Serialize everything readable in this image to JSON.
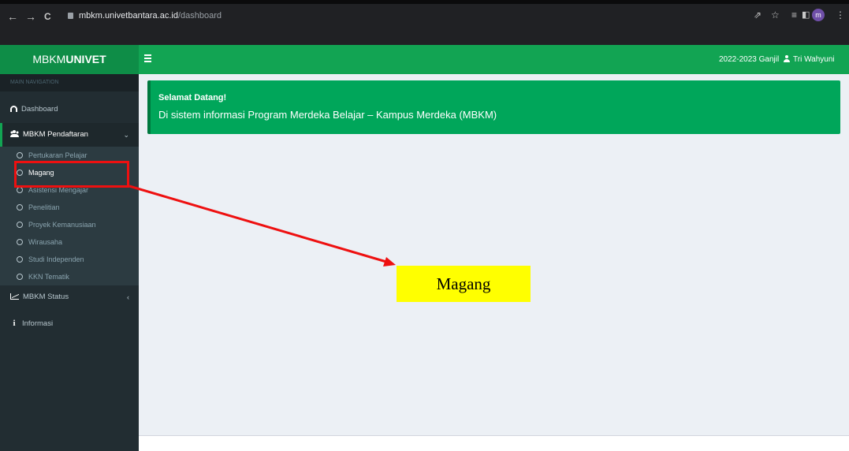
{
  "browser": {
    "url_host": "mbkm.univetbantara.ac.id",
    "url_path": "/dashboard",
    "back_glyph": "←",
    "forward_glyph": "→",
    "reload_glyph": "C",
    "share_glyph": "⇗",
    "star_glyph": "☆",
    "reading_list_glyph": "≡",
    "sidepanel_glyph": "◧",
    "profile_initial": "m",
    "menu_glyph": "⋮"
  },
  "header": {
    "logo_prefix": "MBKM",
    "logo_suffix": "UNIVET",
    "period": "2022-2023 Ganjil",
    "user_name": "Tri Wahyuni"
  },
  "sidebar": {
    "section_header": "MAIN NAVIGATION",
    "dashboard_label": "Dashboard",
    "pendaftaran_label": "MBKM Pendaftaran",
    "pendaftaran_caret": "⌄",
    "submenu": [
      {
        "label": "Pertukaran Pelajar"
      },
      {
        "label": "Magang"
      },
      {
        "label": "Asistensi Mengajar"
      },
      {
        "label": "Penelitian"
      },
      {
        "label": "Proyek Kemanusiaan"
      },
      {
        "label": "Wirausaha"
      },
      {
        "label": "Studi Independen"
      },
      {
        "label": "KKN Tematik"
      }
    ],
    "status_label": "MBKM Status",
    "status_caret": "‹",
    "informasi_icon": "i",
    "informasi_label": "Informasi"
  },
  "alert": {
    "title": "Selamat Datang!",
    "text": "Di sistem informasi Program Merdeka Belajar – Kampus Merdeka (MBKM)"
  },
  "annotation": {
    "callout_label": "Magang"
  },
  "colors": {
    "header_green": "#12a453",
    "logo_green": "#0e8d47",
    "sidebar_bg": "#222d32",
    "alert_green": "#00a65a",
    "annotation_red": "#ee1010",
    "callout_yellow": "#ffff00"
  }
}
